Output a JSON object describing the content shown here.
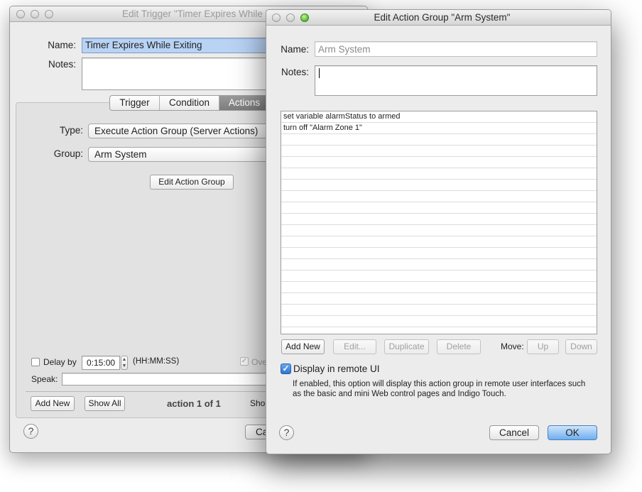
{
  "back_window": {
    "title": "Edit Trigger \"Timer Expires While Exiting\"",
    "name_label": "Name:",
    "name_value": "Timer Expires While Exiting",
    "notes_label": "Notes:",
    "tabs": [
      "Trigger",
      "Condition",
      "Actions"
    ],
    "type_label": "Type:",
    "type_value": "Execute Action Group (Server Actions)",
    "group_label": "Group:",
    "group_value": "Arm System",
    "edit_action_group_button": "Edit Action Group",
    "delay_label": "Delay by",
    "delay_value": "0:15:00",
    "delay_format": "(HH:MM:SS)",
    "override_label": "Ove",
    "speak_label": "Speak:",
    "add_new_button": "Add New",
    "show_all_button": "Show All",
    "action_counter": "action 1 of 1",
    "show_label": "Sho",
    "cancel_button_partial": "Ca",
    "help_glyph": "?"
  },
  "front_window": {
    "title": "Edit Action Group \"Arm System\"",
    "name_label": "Name:",
    "name_value": "Arm System",
    "notes_label": "Notes:",
    "action_list": [
      "set variable alarmStatus to armed",
      "turn off \"Alarm Zone 1\""
    ],
    "add_new_button": "Add New",
    "edit_button": "Edit...",
    "duplicate_button": "Duplicate",
    "delete_button": "Delete",
    "move_label": "Move:",
    "up_button": "Up",
    "down_button": "Down",
    "display_remote_label": "Display in remote UI",
    "display_remote_checked": true,
    "display_remote_help": "If enabled, this option will display this action group in remote user interfaces such as the basic and mini Web control pages and Indigo Touch.",
    "cancel_button": "Cancel",
    "ok_button": "OK",
    "help_glyph": "?"
  },
  "colors": {
    "window_bg": "#ececec",
    "default_button": "#8bbcf0",
    "checkbox_checked": "#3b82d8"
  }
}
